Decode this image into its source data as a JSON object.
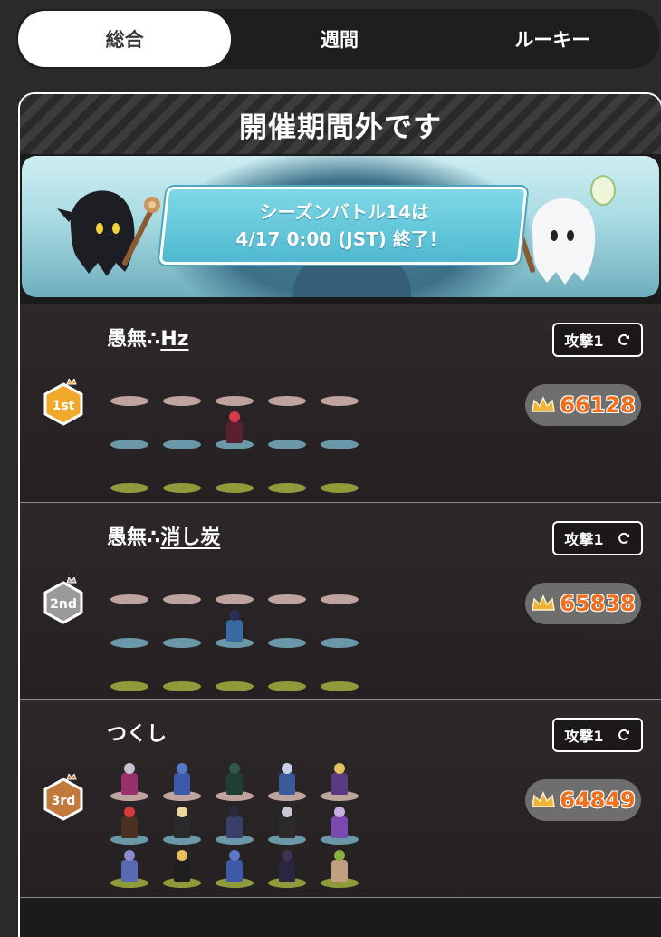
{
  "tabs": [
    {
      "label": "総合",
      "active": true
    },
    {
      "label": "週間",
      "active": false
    },
    {
      "label": "ルーキー",
      "active": false
    }
  ],
  "status_header": "開催期間外です",
  "banner": {
    "line1": "シーズンバトル14は",
    "line2": "4/17 0:00 (JST) 終了！"
  },
  "rankings": [
    {
      "rank_label": "1st",
      "rank_color": "#f0a92a",
      "guild": "愚無∴",
      "handle": "Hz",
      "attack_label": "攻撃1",
      "score": "66128",
      "characters": [
        {
          "row": 1,
          "col": 2,
          "head": "#d93a4a",
          "body": "#5a2030"
        }
      ]
    },
    {
      "rank_label": "2nd",
      "rank_color": "#9a9a9a",
      "guild": "愚無∴",
      "handle": "消し炭",
      "attack_label": "攻撃1",
      "score": "65838",
      "characters": [
        {
          "row": 1,
          "col": 2,
          "head": "#2b2f55",
          "body": "#3a6aa0"
        }
      ]
    },
    {
      "rank_label": "3rd",
      "rank_color": "#c27a3c",
      "guild": "",
      "handle": "つくし",
      "attack_label": "攻撃1",
      "score": "64849",
      "characters": [
        {
          "row": 0,
          "col": 0,
          "head": "#c8c0d0",
          "body": "#9a2f6e"
        },
        {
          "row": 0,
          "col": 1,
          "head": "#5a78c8",
          "body": "#3c5aa8"
        },
        {
          "row": 0,
          "col": 2,
          "head": "#2f5a4a",
          "body": "#1f3f35"
        },
        {
          "row": 0,
          "col": 3,
          "head": "#c8d0e8",
          "body": "#3a5a9a"
        },
        {
          "row": 0,
          "col": 4,
          "head": "#e0c060",
          "body": "#5a3a80"
        },
        {
          "row": 1,
          "col": 0,
          "head": "#d83a3a",
          "body": "#4a3020"
        },
        {
          "row": 1,
          "col": 1,
          "head": "#e8d8a0",
          "body": "#2a2a2a"
        },
        {
          "row": 1,
          "col": 2,
          "head": "#2a2a3a",
          "body": "#3a3f6a"
        },
        {
          "row": 1,
          "col": 3,
          "head": "#c8c8d0",
          "body": "#2a2a2a"
        },
        {
          "row": 1,
          "col": 4,
          "head": "#c8b0e0",
          "body": "#7a4ab0"
        },
        {
          "row": 2,
          "col": 0,
          "head": "#8a8ad0",
          "body": "#5a6ab0"
        },
        {
          "row": 2,
          "col": 1,
          "head": "#e8c060",
          "body": "#1f1f1f"
        },
        {
          "row": 2,
          "col": 2,
          "head": "#5a78c8",
          "body": "#3c5aa8"
        },
        {
          "row": 2,
          "col": 3,
          "head": "#3a3550",
          "body": "#2a2540"
        },
        {
          "row": 2,
          "col": 4,
          "head": "#8ab040",
          "body": "#c0a080"
        }
      ]
    }
  ],
  "colors": {
    "score": "#f06f1d",
    "crown": "#f0b23a",
    "pad_row0": "#bfa39f",
    "pad_row1": "#6a98a8",
    "pad_row2": "#8f9a3a"
  }
}
